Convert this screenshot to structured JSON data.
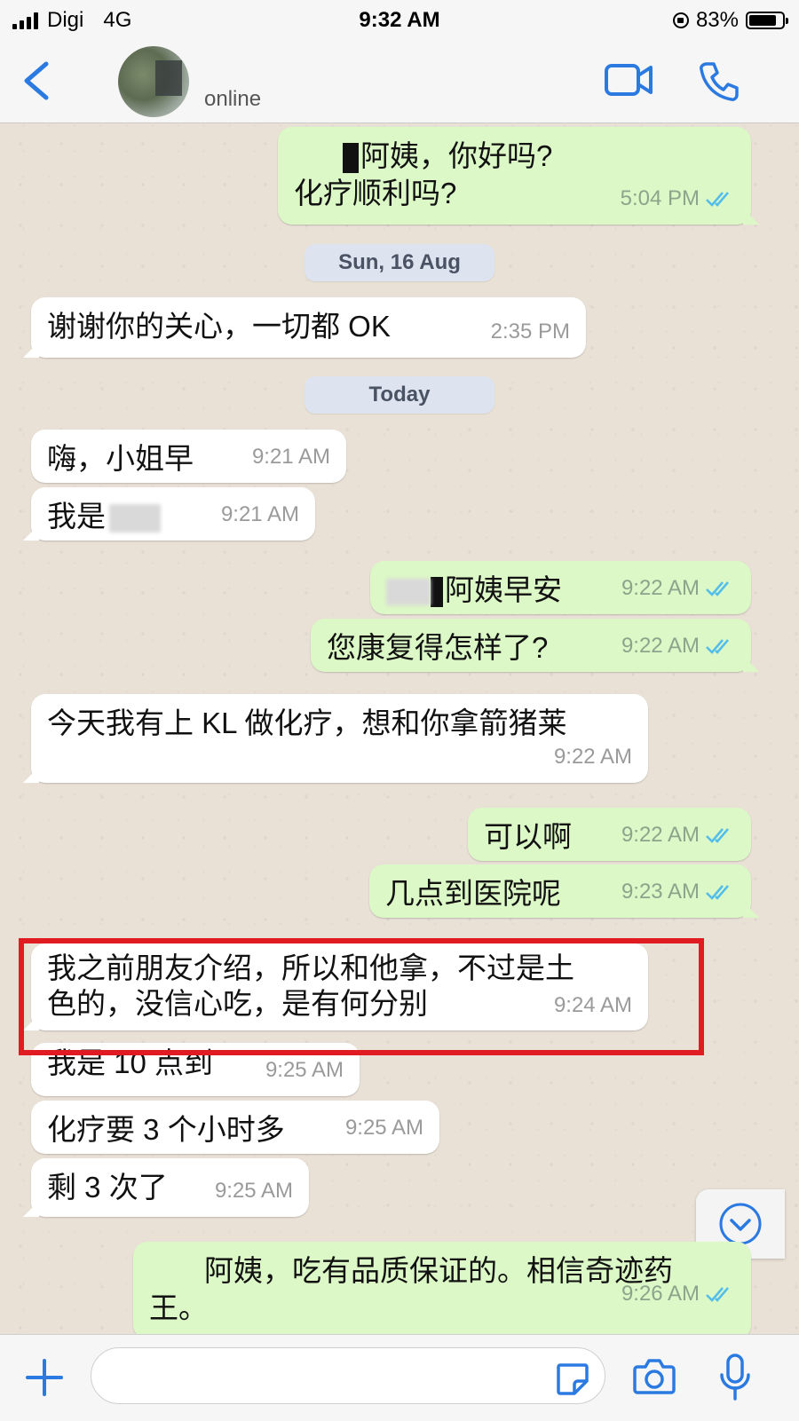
{
  "status_bar": {
    "carrier": "Digi",
    "network": "4G",
    "time": "9:32 AM",
    "battery": "83%",
    "battery_level": 0.83
  },
  "header": {
    "presence": "online",
    "icons": [
      "back-chevron-icon",
      "video-call-icon",
      "voice-call-icon"
    ]
  },
  "colors": {
    "accent": "#2a7ae2",
    "outgoing_bubble": "#dcf8c6",
    "incoming_bubble": "#ffffff",
    "read_ticks": "#53bdeb",
    "highlight": "#e11b22"
  },
  "messages": [
    {
      "dir": "out",
      "text": "阿姨，你好吗?",
      "text2": "化疗顺利吗?",
      "time": "5:04 PM",
      "ticks": "read"
    },
    {
      "type": "date",
      "text": "Sun, 16 Aug"
    },
    {
      "dir": "in",
      "text": "谢谢你的关心，一切都 OK",
      "time": "2:35 PM"
    },
    {
      "type": "date",
      "text": "Today"
    },
    {
      "dir": "in",
      "text": "嗨，小姐早",
      "time": "9:21 AM"
    },
    {
      "dir": "in",
      "text": "我是",
      "time": "9:21 AM"
    },
    {
      "dir": "out",
      "text": "阿姨早安",
      "time": "9:22 AM",
      "ticks": "read"
    },
    {
      "dir": "out",
      "text": "您康复得怎样了?",
      "time": "9:22 AM",
      "ticks": "read"
    },
    {
      "dir": "in",
      "text": "今天我有上 KL 做化疗，想和你拿箭猪莱",
      "time": "9:22 AM"
    },
    {
      "dir": "out",
      "text": "可以啊",
      "time": "9:22 AM",
      "ticks": "read"
    },
    {
      "dir": "out",
      "text": "几点到医院呢",
      "time": "9:23 AM",
      "ticks": "read"
    },
    {
      "dir": "in",
      "text": "我之前朋友介绍，所以和他拿，不过是土",
      "text2": "色的，没信心吃，是有何分别",
      "time": "9:24 AM",
      "highlighted": true
    },
    {
      "dir": "in",
      "text": "我是 10 点到",
      "time": "9:25 AM"
    },
    {
      "dir": "in",
      "text": "化疗要 3 个小时多",
      "time": "9:25 AM"
    },
    {
      "dir": "in",
      "text": "剩 3 次了",
      "time": "9:25 AM"
    },
    {
      "dir": "out",
      "text": "阿姨，吃有品质保证的。相信奇迹药",
      "text2": "王。",
      "time": "9:26 AM",
      "ticks": "read"
    }
  ],
  "input_bar": {
    "icons": [
      "plus-icon",
      "sticker-icon",
      "camera-icon",
      "microphone-icon"
    ]
  },
  "scroll_button": {
    "icon": "chevron-down-circle-icon"
  }
}
